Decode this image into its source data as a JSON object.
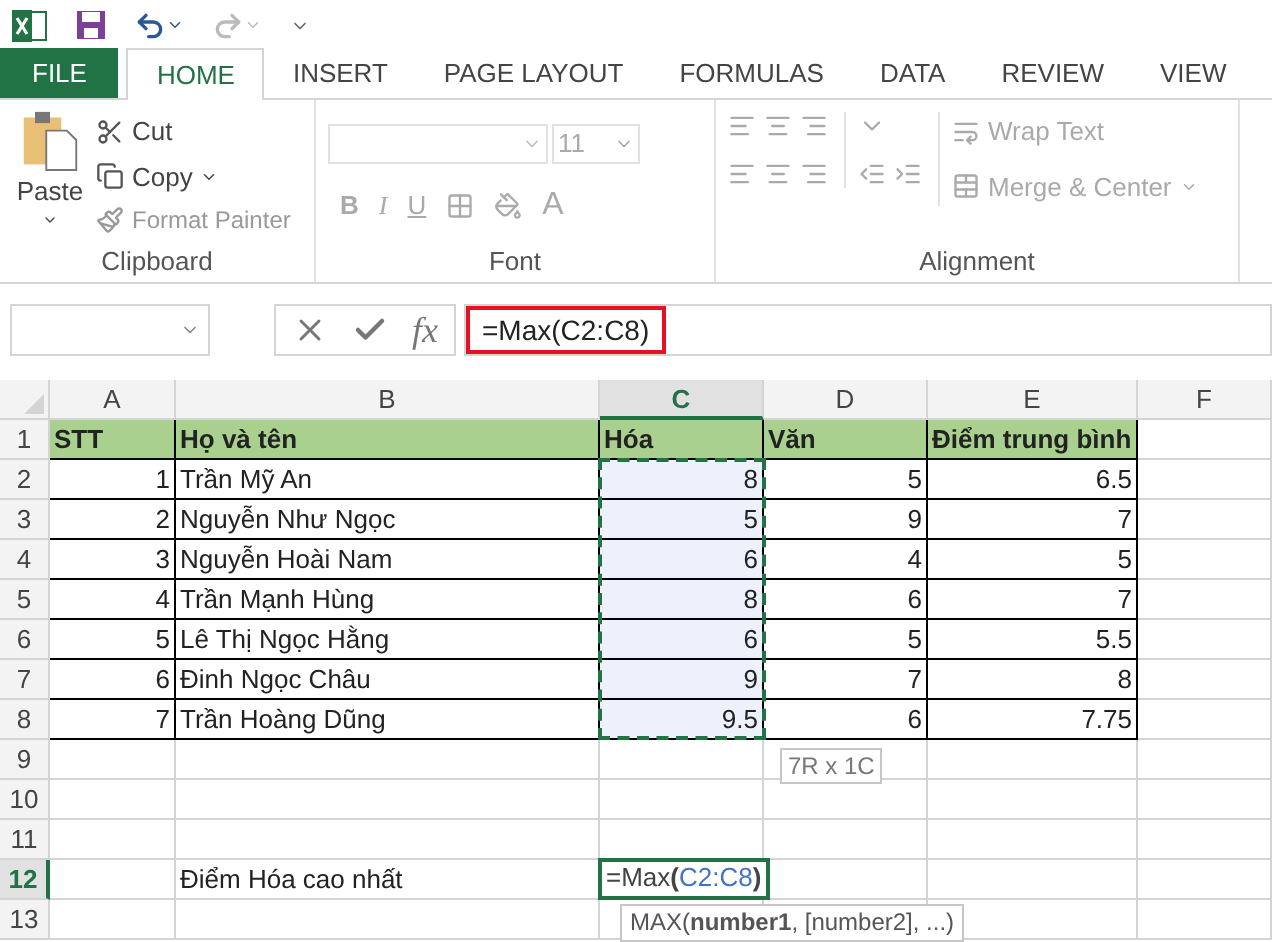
{
  "tabs": [
    {
      "label": "FILE",
      "kind": "file",
      "selected": false
    },
    {
      "label": "HOME",
      "kind": "tab",
      "selected": true
    },
    {
      "label": "INSERT",
      "kind": "tab",
      "selected": false
    },
    {
      "label": "PAGE LAYOUT",
      "kind": "tab",
      "selected": false
    },
    {
      "label": "FORMULAS",
      "kind": "tab",
      "selected": false
    },
    {
      "label": "DATA",
      "kind": "tab",
      "selected": false
    },
    {
      "label": "REVIEW",
      "kind": "tab",
      "selected": false
    },
    {
      "label": "VIEW",
      "kind": "tab",
      "selected": false
    }
  ],
  "clipboard": {
    "paste": "Paste",
    "cut": "Cut",
    "copy": "Copy",
    "format_painter": "Format Painter",
    "label": "Clipboard"
  },
  "font": {
    "size": "11",
    "bold": "B",
    "italic": "I",
    "underline": "U",
    "font_color": "A",
    "label": "Font"
  },
  "alignment": {
    "wrap": "Wrap Text",
    "merge": "Merge & Center",
    "label": "Alignment"
  },
  "formula_bar": {
    "fx": "fx",
    "formula": "=Max(C2:C8)",
    "highlighted": true
  },
  "columns": [
    {
      "label": "A",
      "selected": false
    },
    {
      "label": "B",
      "selected": false
    },
    {
      "label": "C",
      "selected": true
    },
    {
      "label": "D",
      "selected": false
    },
    {
      "label": "E",
      "selected": false
    },
    {
      "label": "F",
      "selected": false
    }
  ],
  "rows": [
    {
      "label": "1",
      "selected": false,
      "cells": {
        "A": {
          "text": "STT",
          "kind": "heading",
          "selected": false
        },
        "B": {
          "text": "Họ và tên",
          "kind": "heading",
          "selected": false
        },
        "C": {
          "text": "Hóa",
          "kind": "heading",
          "selected": false
        },
        "D": {
          "text": "Văn",
          "kind": "heading",
          "selected": false
        },
        "E": {
          "text": "Điểm trung bình",
          "kind": "heading",
          "selected": false
        }
      }
    },
    {
      "label": "2",
      "selected": false,
      "cells": {
        "A": {
          "text": "1",
          "kind": "number",
          "selected": false
        },
        "B": {
          "text": "Trần Mỹ An",
          "kind": "text",
          "selected": false
        },
        "C": {
          "text": "8",
          "kind": "number",
          "selected": true
        },
        "D": {
          "text": "5",
          "kind": "number",
          "selected": false
        },
        "E": {
          "text": "6.5",
          "kind": "number",
          "selected": false
        }
      }
    },
    {
      "label": "3",
      "selected": false,
      "cells": {
        "A": {
          "text": "2",
          "kind": "number",
          "selected": false
        },
        "B": {
          "text": "Nguyễn Như Ngọc",
          "kind": "text",
          "selected": false
        },
        "C": {
          "text": "5",
          "kind": "number",
          "selected": true
        },
        "D": {
          "text": "9",
          "kind": "number",
          "selected": false
        },
        "E": {
          "text": "7",
          "kind": "number",
          "selected": false
        }
      }
    },
    {
      "label": "4",
      "selected": false,
      "cells": {
        "A": {
          "text": "3",
          "kind": "number",
          "selected": false
        },
        "B": {
          "text": "Nguyễn Hoài Nam",
          "kind": "text",
          "selected": false
        },
        "C": {
          "text": "6",
          "kind": "number",
          "selected": true
        },
        "D": {
          "text": "4",
          "kind": "number",
          "selected": false
        },
        "E": {
          "text": "5",
          "kind": "number",
          "selected": false
        }
      }
    },
    {
      "label": "5",
      "selected": false,
      "cells": {
        "A": {
          "text": "4",
          "kind": "number",
          "selected": false
        },
        "B": {
          "text": "Trần Mạnh Hùng",
          "kind": "text",
          "selected": false
        },
        "C": {
          "text": "8",
          "kind": "number",
          "selected": true
        },
        "D": {
          "text": "6",
          "kind": "number",
          "selected": false
        },
        "E": {
          "text": "7",
          "kind": "number",
          "selected": false
        }
      }
    },
    {
      "label": "6",
      "selected": false,
      "cells": {
        "A": {
          "text": "5",
          "kind": "number",
          "selected": false
        },
        "B": {
          "text": "Lê Thị Ngọc Hằng",
          "kind": "text",
          "selected": false
        },
        "C": {
          "text": "6",
          "kind": "number",
          "selected": true
        },
        "D": {
          "text": "5",
          "kind": "number",
          "selected": false
        },
        "E": {
          "text": "5.5",
          "kind": "number",
          "selected": false
        }
      }
    },
    {
      "label": "7",
      "selected": false,
      "cells": {
        "A": {
          "text": "6",
          "kind": "number",
          "selected": false
        },
        "B": {
          "text": "Đinh Ngọc Châu",
          "kind": "text",
          "selected": false
        },
        "C": {
          "text": "9",
          "kind": "number",
          "selected": true
        },
        "D": {
          "text": "7",
          "kind": "number",
          "selected": false
        },
        "E": {
          "text": "8",
          "kind": "number",
          "selected": false
        }
      }
    },
    {
      "label": "8",
      "selected": false,
      "cells": {
        "A": {
          "text": "7",
          "kind": "number",
          "selected": false
        },
        "B": {
          "text": "Trần Hoàng Dũng",
          "kind": "text",
          "selected": false
        },
        "C": {
          "text": "9.5",
          "kind": "number",
          "selected": true
        },
        "D": {
          "text": "6",
          "kind": "number",
          "selected": false
        },
        "E": {
          "text": "7.75",
          "kind": "number",
          "selected": false
        }
      }
    },
    {
      "label": "9",
      "selected": false,
      "cells": {}
    },
    {
      "label": "10",
      "selected": false,
      "cells": {}
    },
    {
      "label": "11",
      "selected": false,
      "cells": {}
    },
    {
      "label": "12",
      "selected": true,
      "cells": {
        "B": {
          "text": "Điểm Hóa cao nhất",
          "kind": "plain",
          "selected": false
        },
        "C": {
          "kind": "editing",
          "selected": false,
          "parts": [
            {
              "text": "=Max",
              "kind": "plain"
            },
            {
              "text": "(",
              "kind": "paren"
            },
            {
              "text": "C2:C8",
              "kind": "ref"
            },
            {
              "text": ")",
              "kind": "paren"
            }
          ]
        }
      }
    },
    {
      "label": "13",
      "selected": false,
      "cells": {}
    }
  ],
  "range_tip": "7R x 1C",
  "function_tip": "MAX(**number1**, [number2], ...)"
}
